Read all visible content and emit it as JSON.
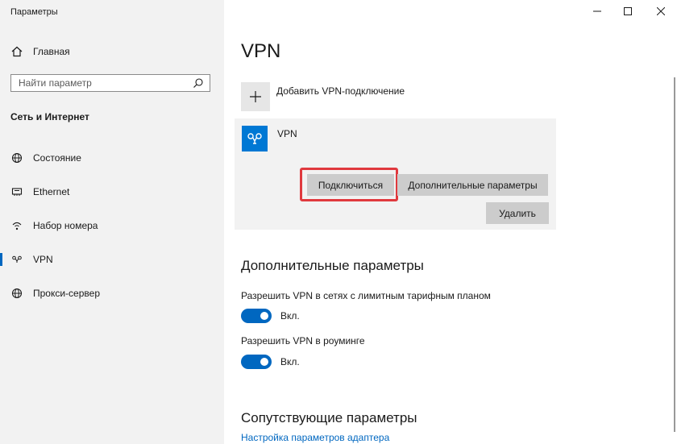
{
  "window": {
    "title": "Параметры"
  },
  "sidebar": {
    "home_label": "Главная",
    "search": {
      "placeholder": "Найти параметр",
      "value": ""
    },
    "section_title": "Сеть и Интернет",
    "items": [
      {
        "label": "Состояние",
        "icon": "globe-icon",
        "active": false
      },
      {
        "label": "Ethernet",
        "icon": "ethernet-icon",
        "active": false
      },
      {
        "label": "Набор номера",
        "icon": "dialup-icon",
        "active": false
      },
      {
        "label": "VPN",
        "icon": "vpn-icon",
        "active": true
      },
      {
        "label": "Прокси-сервер",
        "icon": "globe-icon",
        "active": false
      }
    ]
  },
  "main": {
    "title": "VPN",
    "add_vpn_label": "Добавить VPN-подключение",
    "vpn_entry": {
      "name": "VPN",
      "connect_label": "Подключиться",
      "advanced_label": "Дополнительные параметры",
      "delete_label": "Удалить"
    },
    "advanced": {
      "heading": "Дополнительные параметры",
      "options": [
        {
          "label": "Разрешить VPN в сетях с лимитным тарифным планом",
          "state_label": "Вкл.",
          "on": true
        },
        {
          "label": "Разрешить VPN в роуминге",
          "state_label": "Вкл.",
          "on": true
        }
      ]
    },
    "related": {
      "heading": "Сопутствующие параметры",
      "link": "Настройка параметров адаптера"
    }
  },
  "colors": {
    "accent": "#0067c0",
    "highlight": "#e0393e",
    "sidebar_bg": "#f2f2f2",
    "button_bg": "#cccccc"
  }
}
